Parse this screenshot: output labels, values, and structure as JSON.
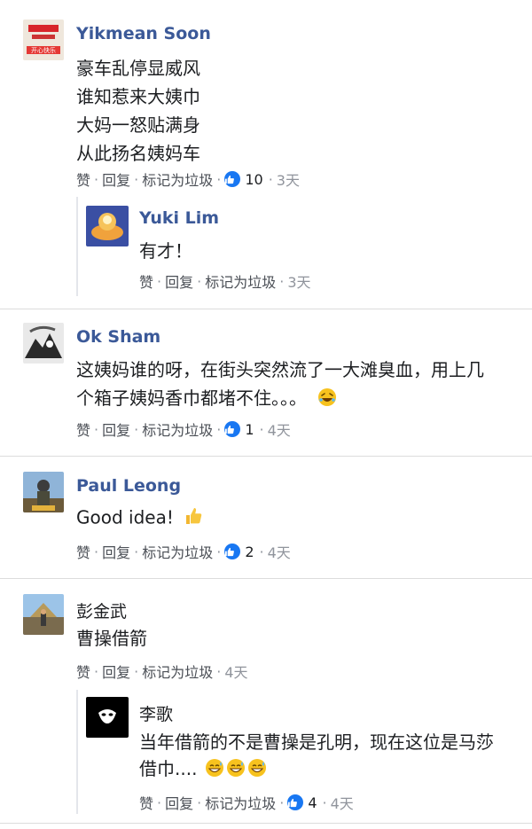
{
  "actions": {
    "like": "赞",
    "reply": "回复",
    "spam": "标记为垃圾",
    "sep": "·"
  },
  "comments": [
    {
      "author": "Yikmean Soon",
      "avatar_text": "开心快乐",
      "lines": [
        "豪车乱停显威风",
        "谁知惹来大姨巾",
        "大妈一怒贴满身",
        "从此扬名姨妈车"
      ],
      "likes": "10",
      "time": "3天",
      "reply": {
        "author": "Yuki Lim",
        "lines": [
          "有才！"
        ],
        "time": "3天"
      }
    },
    {
      "author": "Ok Sham",
      "lines": [
        "这姨妈谁的呀，在街头突然流了一大滩臭血，用上几",
        "个箱子姨妈香巾都堵不住。。。"
      ],
      "likes": "1",
      "time": "4天"
    },
    {
      "author": "Paul Leong",
      "lines": [
        "Good idea!"
      ],
      "likes": "2",
      "time": "4天"
    },
    {
      "author": "彭金武",
      "lines": [
        "曹操借箭"
      ],
      "time": "4天",
      "reply": {
        "author": "李歌",
        "lines": [
          "当年借箭的不是曹操是孔明，现在这位是马莎",
          "借巾...."
        ],
        "likes": "4",
        "time": "4天"
      }
    }
  ],
  "colors": {
    "link": "#3b5998",
    "like": "#1877f2",
    "meta": "#616770"
  }
}
